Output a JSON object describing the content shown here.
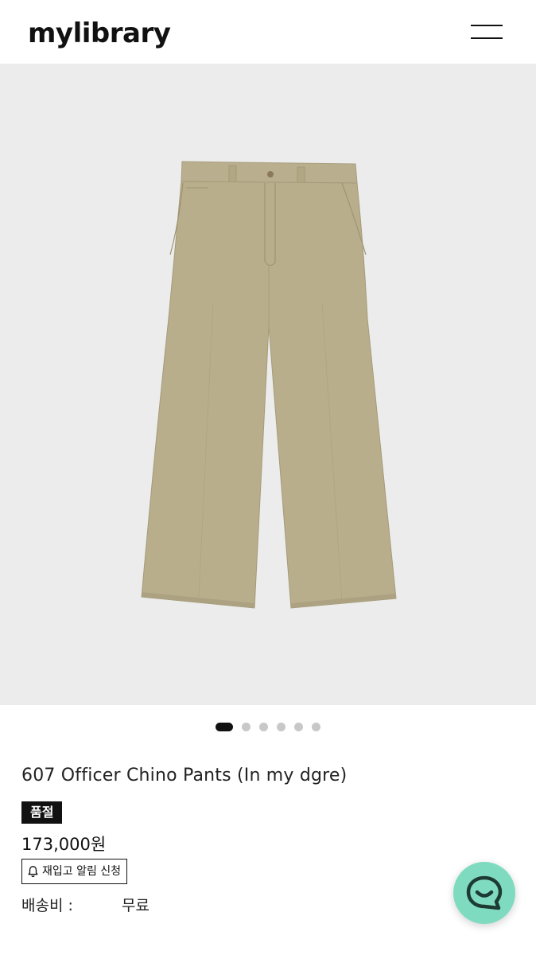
{
  "header": {
    "logo": "mylibrary",
    "menu_icon": "hamburger-menu-icon"
  },
  "gallery": {
    "image_description_icon": "product-image",
    "total_slides": 6,
    "active_slide": 1
  },
  "product": {
    "title": "607 Officer Chino Pants (In my dgre)",
    "badge": "품절",
    "price": "173,000원",
    "restock_button": "재입고 알림 신청",
    "shipping_label": "배송비 :",
    "shipping_value": "무료"
  },
  "colors": {
    "accent_chat": "#7fdbbf",
    "badge_bg": "#111111",
    "product_color": "#b8ae8c"
  },
  "chat": {
    "icon": "chat-bubble-icon"
  }
}
